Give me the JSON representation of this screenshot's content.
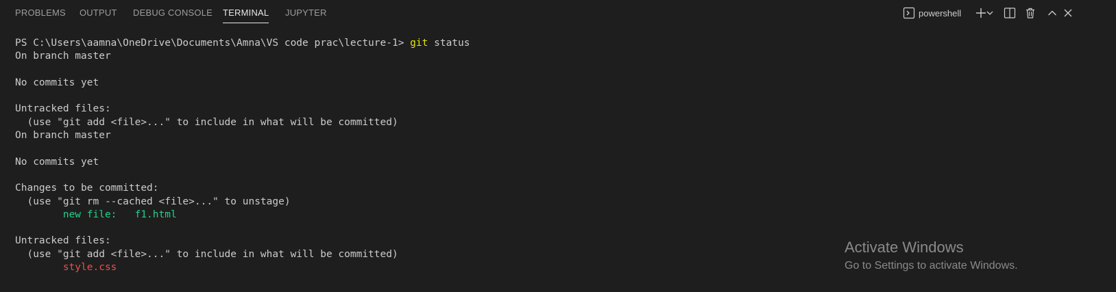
{
  "tabs": [
    {
      "label": "PROBLEMS"
    },
    {
      "label": "OUTPUT"
    },
    {
      "label": "DEBUG CONSOLE"
    },
    {
      "label": "TERMINAL"
    },
    {
      "label": "JUPYTER"
    }
  ],
  "active_tab": "TERMINAL",
  "toolbar": {
    "shell_name": "powershell",
    "icons": [
      "terminal-icon",
      "plus-icon",
      "chevron-down-icon",
      "split-icon",
      "trash-icon",
      "chevron-up-icon",
      "close-icon"
    ]
  },
  "terminal": {
    "prompt": "PS C:\\Users\\aamna\\OneDrive\\Documents\\Amna\\VS code prac\\lecture-1> ",
    "command_git": "git",
    "command_rest": " status",
    "lines": [
      "On branch master",
      "",
      "No commits yet",
      "",
      "Untracked files:",
      "  (use \"git add <file>...\" to include in what will be committed)",
      "On branch master",
      "",
      "No commits yet",
      "",
      "Changes to be committed:",
      "  (use \"git rm --cached <file>...\" to unstage)",
      "        new file:   f1.html",
      "",
      "Untracked files:",
      "  (use \"git add <file>...\" to include in what will be committed)",
      "        style.css"
    ]
  },
  "watermark": {
    "title": "Activate Windows",
    "subtitle": "Go to Settings to activate Windows."
  },
  "colors": {
    "background": "#1e1e1e",
    "text": "#cccccc",
    "command": "#e5e510",
    "staged": "#23d18b",
    "untracked": "#f14c4c"
  }
}
